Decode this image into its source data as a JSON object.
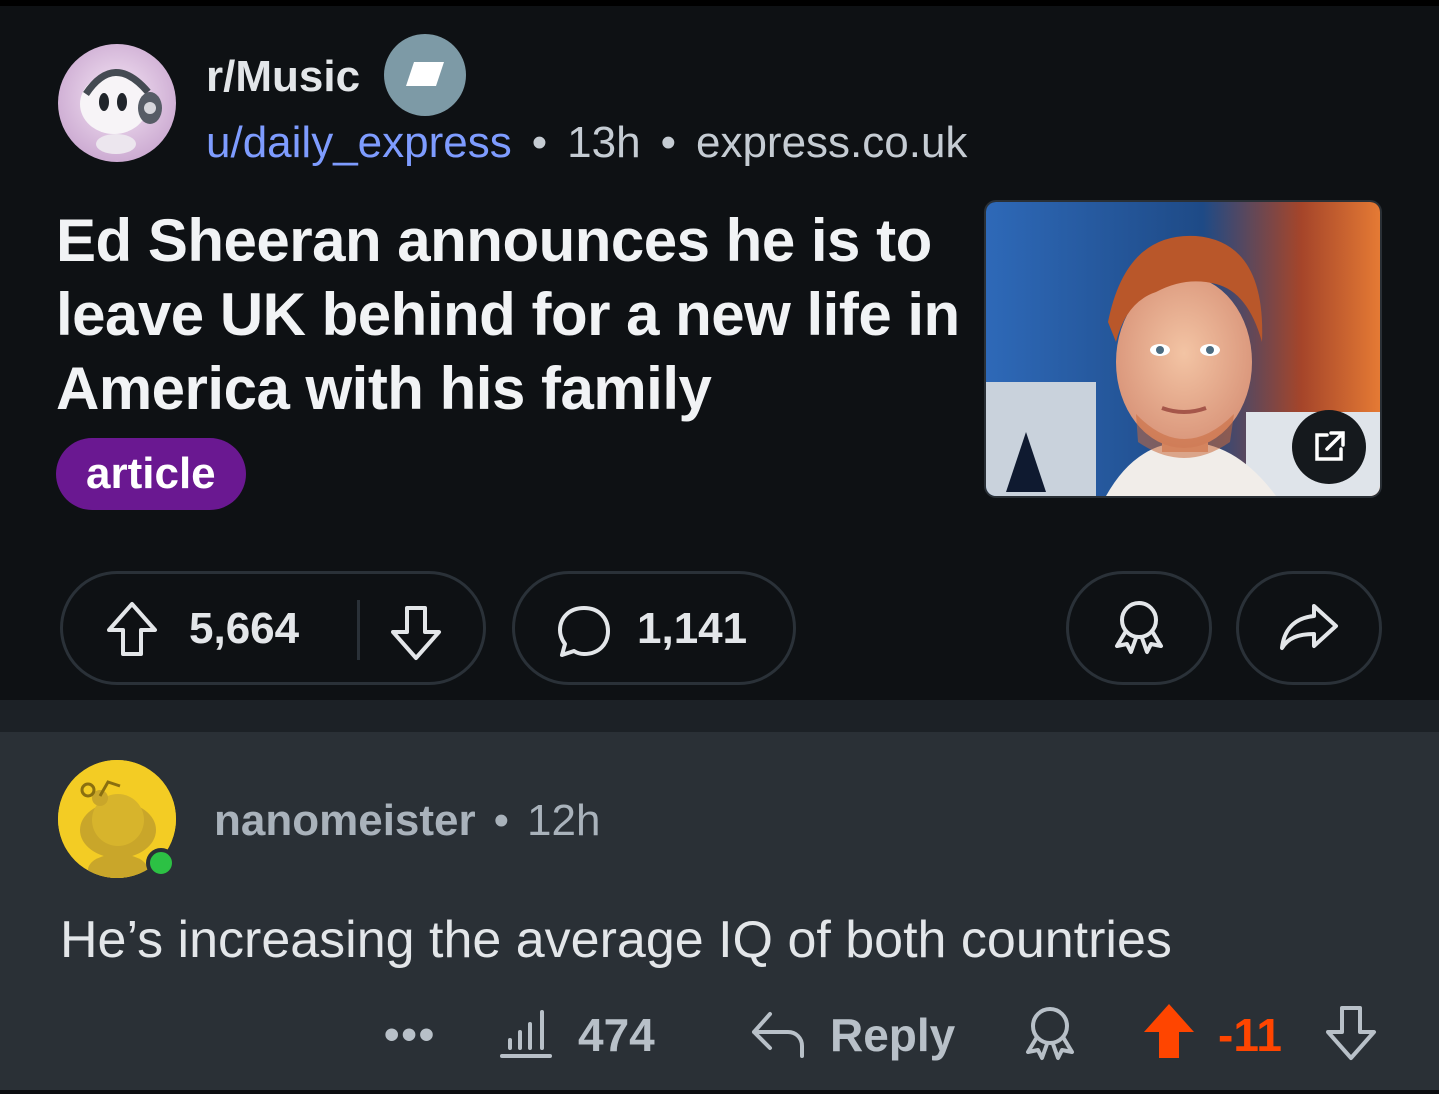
{
  "post": {
    "subreddit": "r/Music",
    "author": "u/daily_express",
    "separator": "•",
    "age": "13h",
    "domain": "express.co.uk",
    "title": "Ed Sheeran announces he is to leave UK behind for a new life in America with his family",
    "flair": "article",
    "score": "5,664",
    "comment_count": "1,141",
    "flair_color": "#6a1891",
    "link_color": "#7e9cff"
  },
  "comment": {
    "author": "nanomeister",
    "separator": "•",
    "age": "12h",
    "body": "He’s increasing the average IQ of both countries",
    "more": "•••",
    "insights": "474",
    "reply_label": "Reply",
    "score": "-11",
    "upvote_color": "#ff4500",
    "avatar_color": "#f3cc24",
    "online_color": "#2cc144"
  },
  "icons": [
    "upvote-icon",
    "downvote-icon",
    "comment-icon",
    "award-icon",
    "share-icon",
    "external-link-icon",
    "insights-icon",
    "reply-icon",
    "more-icon"
  ]
}
